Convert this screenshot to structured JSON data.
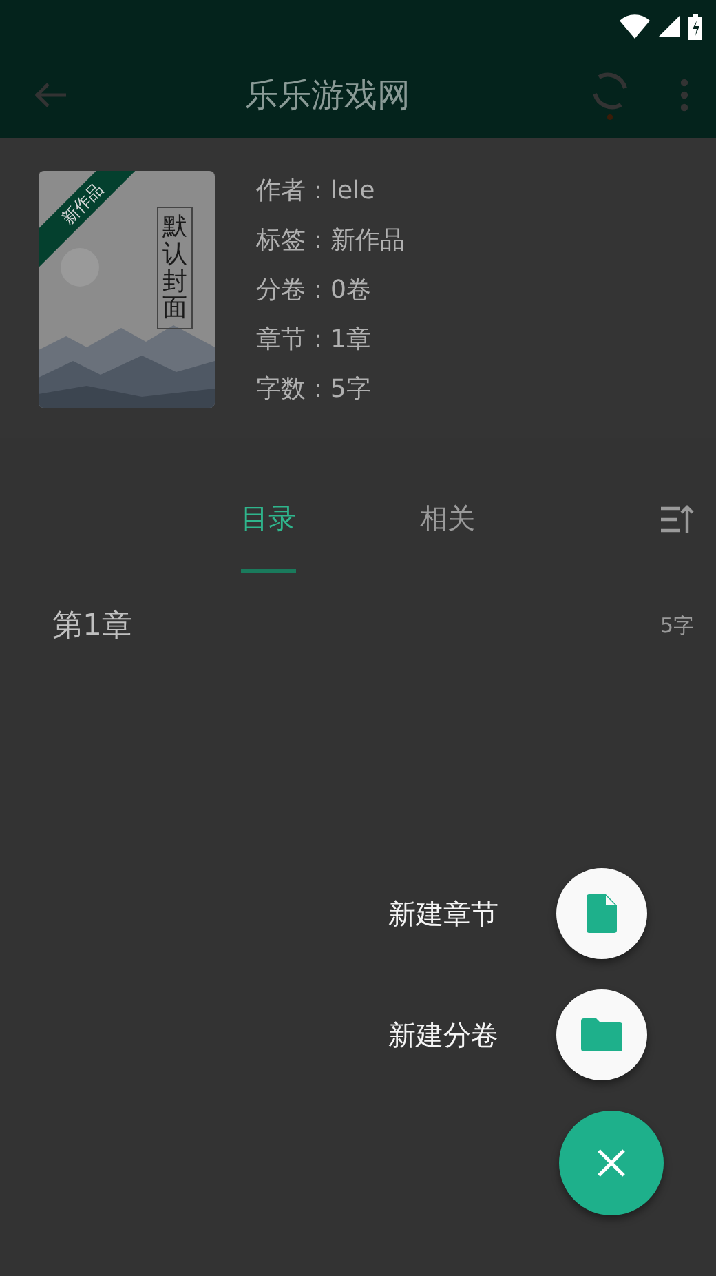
{
  "app_bar": {
    "title": "乐乐游戏网"
  },
  "book": {
    "cover": {
      "ribbon": "新作品",
      "title": "默认封面"
    },
    "info": [
      "作者：lele",
      "标签：新作品",
      "分卷：0卷",
      "章节：1章",
      "字数：5字"
    ]
  },
  "tabs": [
    {
      "label": "目录",
      "selected": true
    },
    {
      "label": "相关",
      "selected": false
    }
  ],
  "chapters": [
    {
      "title": "第1章",
      "count": "5字"
    }
  ],
  "fab_menu": {
    "expanded": true,
    "items": [
      {
        "label": "新建章节",
        "kind": "file"
      },
      {
        "label": "新建分卷",
        "kind": "folder"
      }
    ]
  }
}
